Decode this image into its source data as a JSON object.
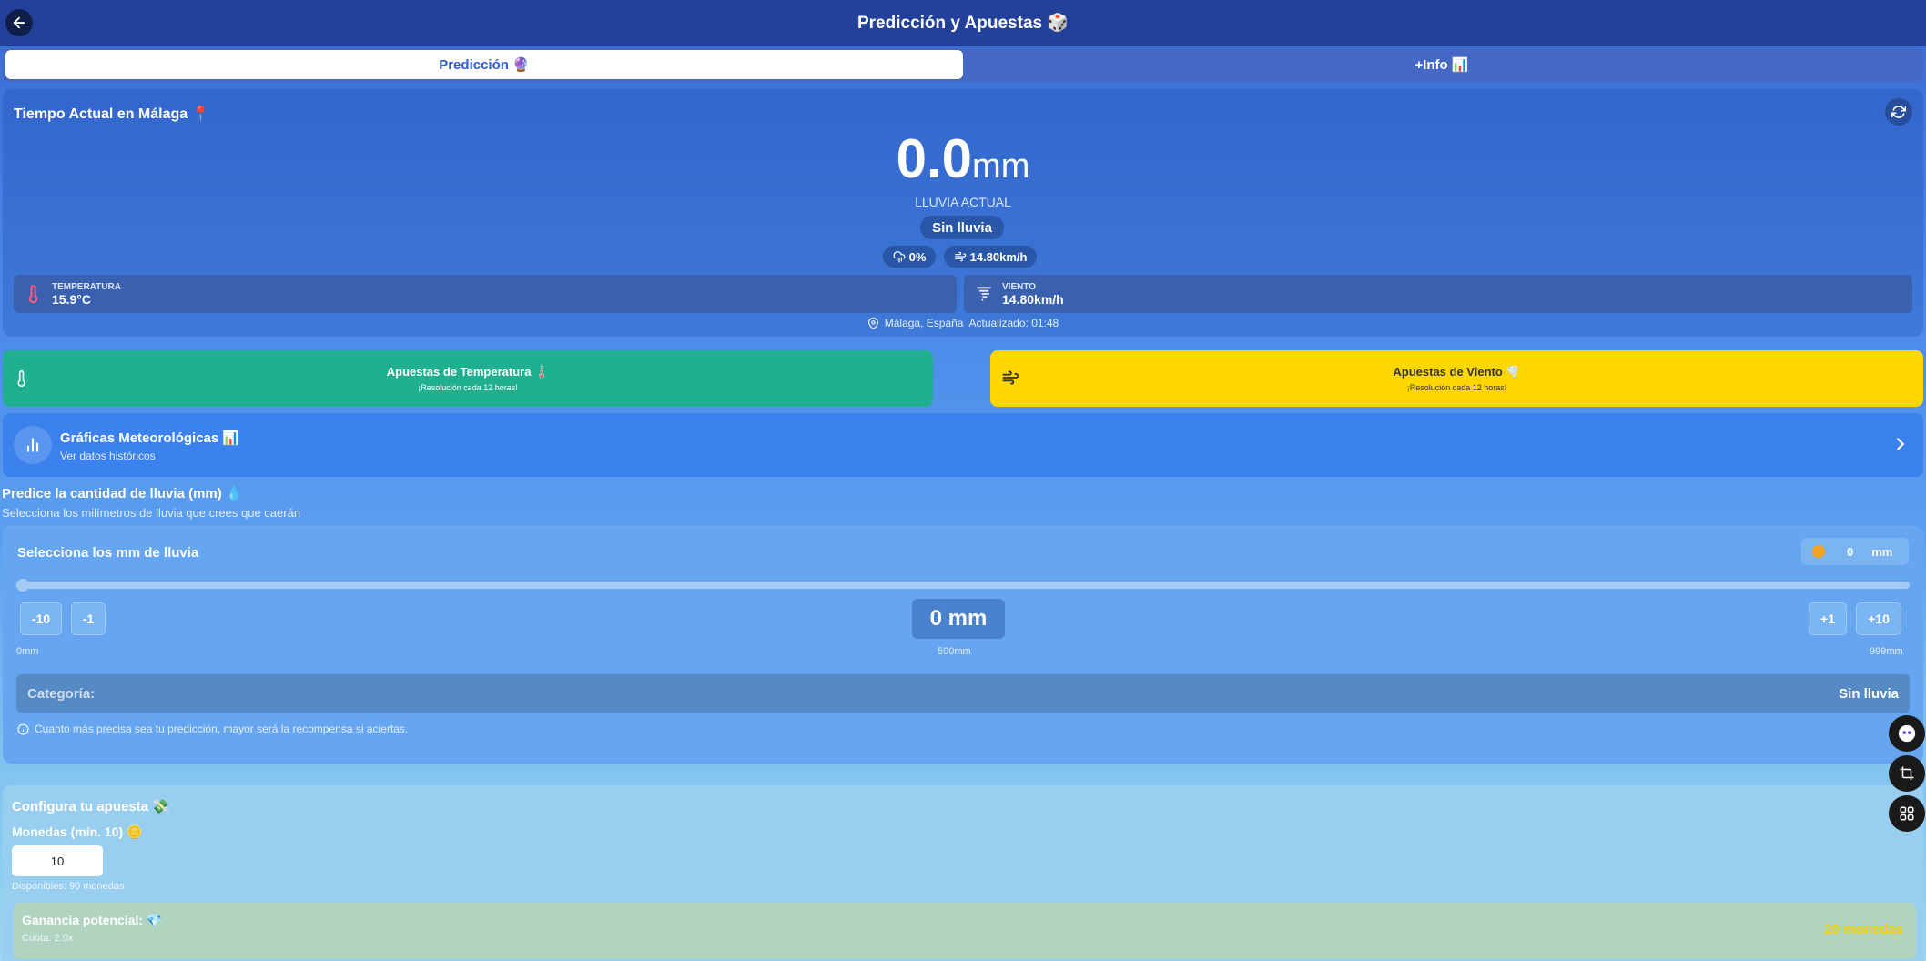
{
  "header": {
    "title": "Predicción y Apuestas 🎲"
  },
  "tabs": [
    {
      "label": "Predicción 🔮",
      "active": true
    },
    {
      "label": "+Info 📊",
      "active": false
    }
  ],
  "weather": {
    "title": "Tiempo Actual en Málaga 📍",
    "rain_value": "0.0",
    "rain_unit": "mm",
    "rain_label": "LLUVIA ACTUAL",
    "rain_status": "Sin lluvia",
    "rain_prob": "0%",
    "wind_pill": "14.80km/h",
    "temperature_label": "TEMPERATURA",
    "temperature_value": "15.9°C",
    "wind_label": "VIENTO",
    "wind_value": "14.80km/h",
    "location": "Málaga, España",
    "updated": "Actualizado: 01:48"
  },
  "bets": {
    "temp_title": "Apuestas de Temperatura 🌡️",
    "temp_sub": "¡Resolución cada 12 horas!",
    "wind_title": "Apuestas de Viento 🌪️",
    "wind_sub": "¡Resolución cada 12 horas!"
  },
  "charts": {
    "title": "Gráficas Meteorológicas 📊",
    "subtitle": "Ver datos históricos"
  },
  "predict": {
    "title": "Predice la cantidad de lluvia (mm) 💧",
    "subtitle": "Selecciona los milímetros de lluvia que crees que caerán",
    "slider_title": "Selecciona los mm de lluvia",
    "coin_value": "0",
    "coin_unit": "mm",
    "slider_fraction": 0,
    "btn_minus10": "-10",
    "btn_minus1": "-1",
    "btn_plus1": "+1",
    "btn_plus10": "+10",
    "display": "0 mm",
    "scale_min": "0mm",
    "scale_mid": "500mm",
    "scale_max": "999mm",
    "category_label": "Categoría:",
    "category_value": "Sin lluvia",
    "hint": "Cuanto más precisa sea tu predicción, mayor será la recompensa si aciertas."
  },
  "config": {
    "title": "Configura tu apuesta 💸",
    "coins_label": "Monedas (mín. 10) 🪙",
    "coins_value": "10",
    "available": "Disponibles: 90 monedas",
    "gain_label": "Ganancia potencial: 💎",
    "cuota": "Cuota: 2.0x",
    "gain_value": "20 monedas"
  },
  "colors": {
    "header_bg": "#23409a",
    "temp_bet": "#20b090",
    "wind_bet": "#ffd700",
    "gain_text": "#f5d000"
  },
  "icons": [
    "arrow-left-icon",
    "refresh-icon",
    "thermometer-icon",
    "wind-icon",
    "bar-chart-icon",
    "chevron-right-icon",
    "info-icon",
    "map-pin-icon",
    "coin-icon",
    "robot-icon",
    "crop-icon",
    "grid-icon"
  ]
}
